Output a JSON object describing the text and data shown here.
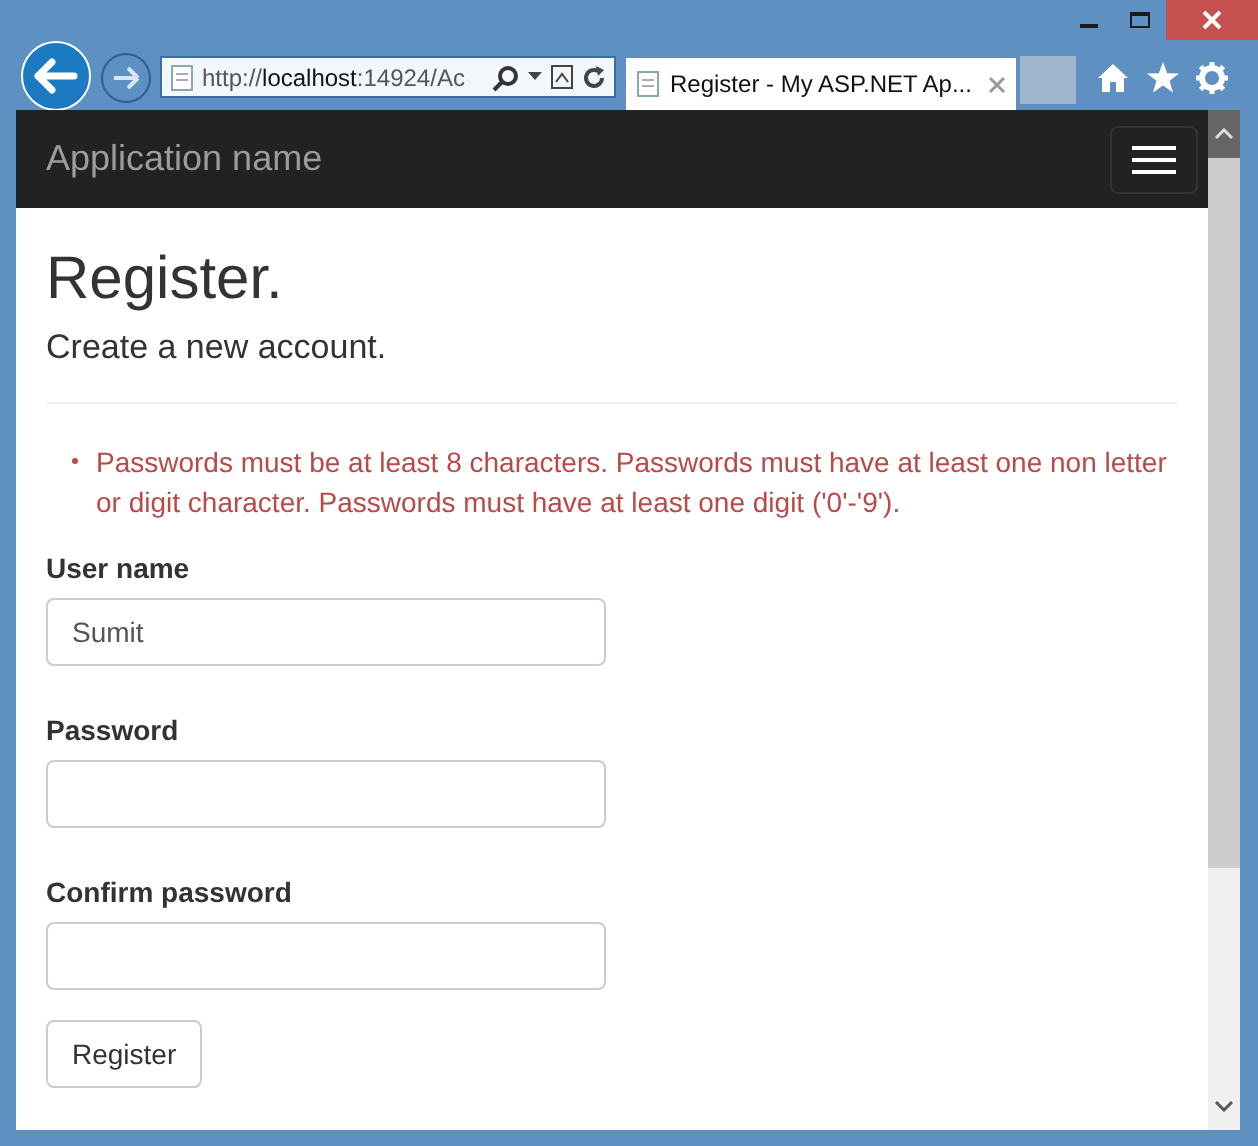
{
  "browser": {
    "address": {
      "prefix": "http://",
      "host": "localhost",
      "rest": ":14924/Ac"
    },
    "tabs": [
      {
        "label": "Register - My ASP.NET Ap...",
        "selected": true
      }
    ]
  },
  "navbar": {
    "brand": "Application name"
  },
  "page": {
    "title": "Register.",
    "subtitle": "Create a new account.",
    "errors": [
      "Passwords must be at least 8 characters. Passwords must have at least one non letter or digit character. Passwords must have at least one digit ('0'-'9')."
    ],
    "fields": [
      {
        "label": "User name",
        "value": "Sumit"
      },
      {
        "label": "Password"
      },
      {
        "label": "Confirm password"
      }
    ],
    "submit": "Register"
  }
}
